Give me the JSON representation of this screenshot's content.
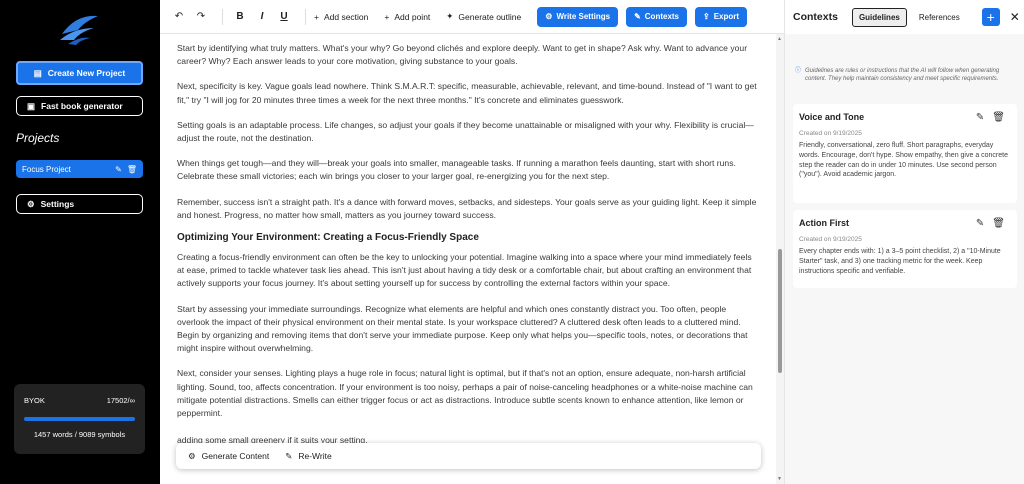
{
  "sidebar": {
    "create_label": "Create New Project",
    "fast_book_label": "Fast book generator",
    "projects_heading": "Projects",
    "project_name": "Focus Project",
    "settings_label": "Settings",
    "usage": {
      "plan": "BYOK",
      "quota": "17502/∞",
      "progress": 1,
      "words": "1457 words / 9089 symbols"
    }
  },
  "toolbar": {
    "add_section": "Add section",
    "add_point": "Add point",
    "generate_outline": "Generate outline",
    "write_settings": "Write Settings",
    "contexts": "Contexts",
    "export": "Export"
  },
  "editor": {
    "p1": "Start by identifying what truly matters. What's your why? Go beyond clichés and explore deeply. Want to get in shape? Ask why. Want to advance your career? Why? Each answer leads to your core motivation, giving substance to your goals.",
    "p2": "Next, specificity is key. Vague goals lead nowhere. Think S.M.A.R.T: specific, measurable, achievable, relevant, and time-bound. Instead of \"I want to get fit,\" try \"I will jog for 20 minutes three times a week for the next three months.\" It's concrete and eliminates guesswork.",
    "p3": "Setting goals is an adaptable process. Life changes, so adjust your goals if they become unattainable or misaligned with your why. Flexibility is crucial—adjust the route, not the destination.",
    "p4": "When things get tough—and they will—break your goals into smaller, manageable tasks. If running a marathon feels daunting, start with short runs. Celebrate these small victories; each win brings you closer to your larger goal, re-energizing you for the next step.",
    "p5": "Remember, success isn't a straight path. It's a dance with forward moves, setbacks, and sidesteps. Your goals serve as your guiding light. Keep it simple and honest. Progress, no matter how small, matters as you journey toward success.",
    "heading": "Optimizing Your Environment: Creating a Focus-Friendly Space",
    "p6": "Creating a focus-friendly environment can often be the key to unlocking your potential. Imagine walking into a space where your mind immediately feels at ease, primed to tackle whatever task lies ahead. This isn't just about having a tidy desk or a comfortable chair, but about crafting an environment that actively supports your focus journey. It's about setting yourself up for success by controlling the external factors within your space.",
    "p7": "Start by assessing your immediate surroundings. Recognize what elements are helpful and which ones constantly distract you. Too often, people overlook the impact of their physical environment on their mental state. Is your workspace cluttered? A cluttered desk often leads to a cluttered mind. Begin by organizing and removing items that don't serve your immediate purpose. Keep only what helps you—specific tools, notes, or decorations that might inspire without overwhelming.",
    "p8": "Next, consider your senses. Lighting plays a huge role in focus; natural light is optimal, but if that's not an option, ensure adequate, non-harsh artificial lighting. Sound, too, affects concentration. If your environment is too noisy, perhaps a pair of noise-canceling headphones or a white-noise machine can mitigate potential distractions. Smells can either trigger focus or act as distractions. Introduce subtle scents known to enhance attention, like lemon or peppermint.",
    "p9": "adding some small greenery if it suits your setting."
  },
  "float_bar": {
    "generate": "Generate Content",
    "rewrite": "Re-Write"
  },
  "right_panel": {
    "title": "Contexts",
    "tab_guidelines": "Guidelines",
    "tab_references": "References",
    "note": "Guidelines are rules or instructions that the AI will follow when generating content. They help maintain consistency and meet specific requirements.",
    "cards": [
      {
        "title": "Voice and Tone",
        "date": "Created on 9/19/2025",
        "body": "Friendly, conversational, zero fluff. Short paragraphs, everyday words. Encourage, don't hype. Show empathy, then give a concrete step the reader can do in under 10 minutes. Use second person (\"you\"). Avoid academic jargon."
      },
      {
        "title": "Action First",
        "date": "Created on 9/19/2025",
        "body": "Every chapter ends with: 1) a 3–5 point checklist, 2) a \"10-Minute Starter\" task, and 3) one tracking metric for the week. Keep instructions specific and verifiable."
      }
    ]
  },
  "colors": {
    "accent": "#1a73e8",
    "sidebar_bg": "#000000"
  }
}
